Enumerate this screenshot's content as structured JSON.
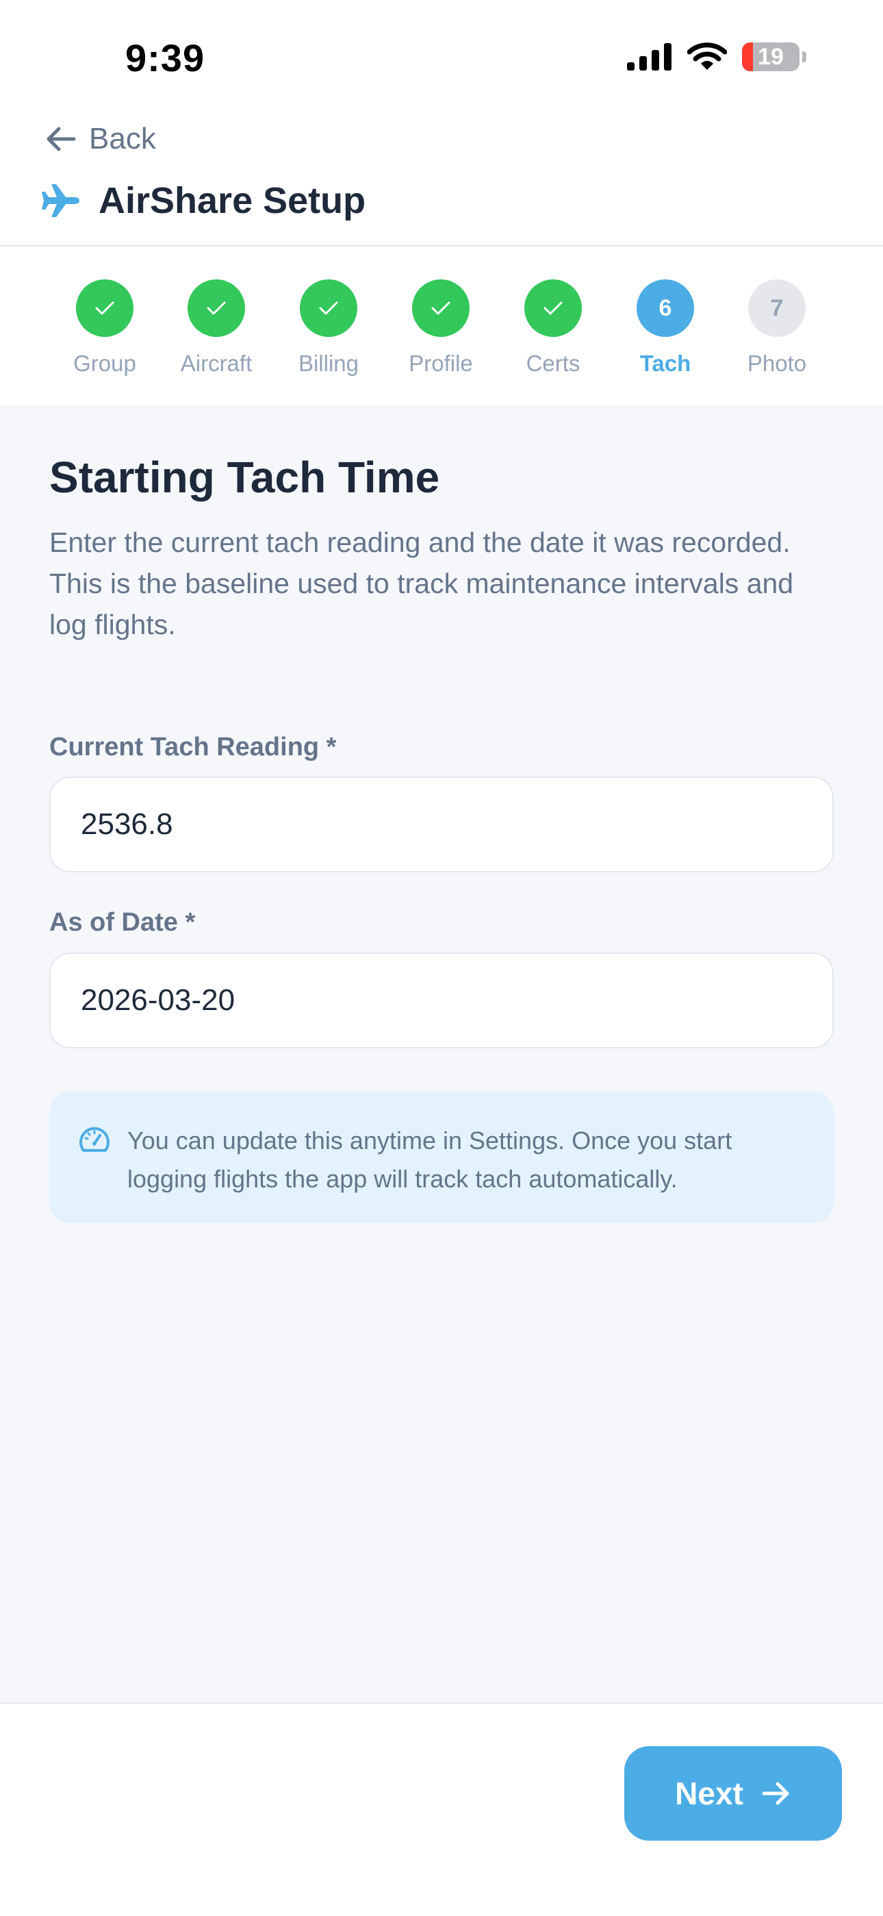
{
  "status_bar": {
    "time": "9:39",
    "battery": "19",
    "battery_fraction": 0.19
  },
  "nav": {
    "back_label": "Back",
    "app_title": "AirShare Setup"
  },
  "stepper": {
    "steps": [
      {
        "number": "1",
        "label": "Group",
        "state": "done"
      },
      {
        "number": "2",
        "label": "Aircraft",
        "state": "done"
      },
      {
        "number": "3",
        "label": "Billing",
        "state": "done"
      },
      {
        "number": "4",
        "label": "Profile",
        "state": "done"
      },
      {
        "number": "5",
        "label": "Certs",
        "state": "done"
      },
      {
        "number": "6",
        "label": "Tach",
        "state": "current"
      },
      {
        "number": "7",
        "label": "Photo",
        "state": "future"
      }
    ]
  },
  "page": {
    "heading": "Starting Tach Time",
    "description": "Enter the current tach reading and the date it was recorded. This is the baseline used to track maintenance intervals and log flights."
  },
  "form": {
    "tach_label": "Current Tach Reading *",
    "tach_value": "2536.8",
    "date_label": "As of Date *",
    "date_value": "2026-03-20"
  },
  "info": {
    "icon": "gauge-icon",
    "text": "You can update this anytime in Settings. Once you start logging flights the app will track tach automatically."
  },
  "footer": {
    "next_label": "Next"
  },
  "colors": {
    "accent": "#4bace6",
    "done": "#34c759",
    "battery_low": "#ff3b30"
  }
}
